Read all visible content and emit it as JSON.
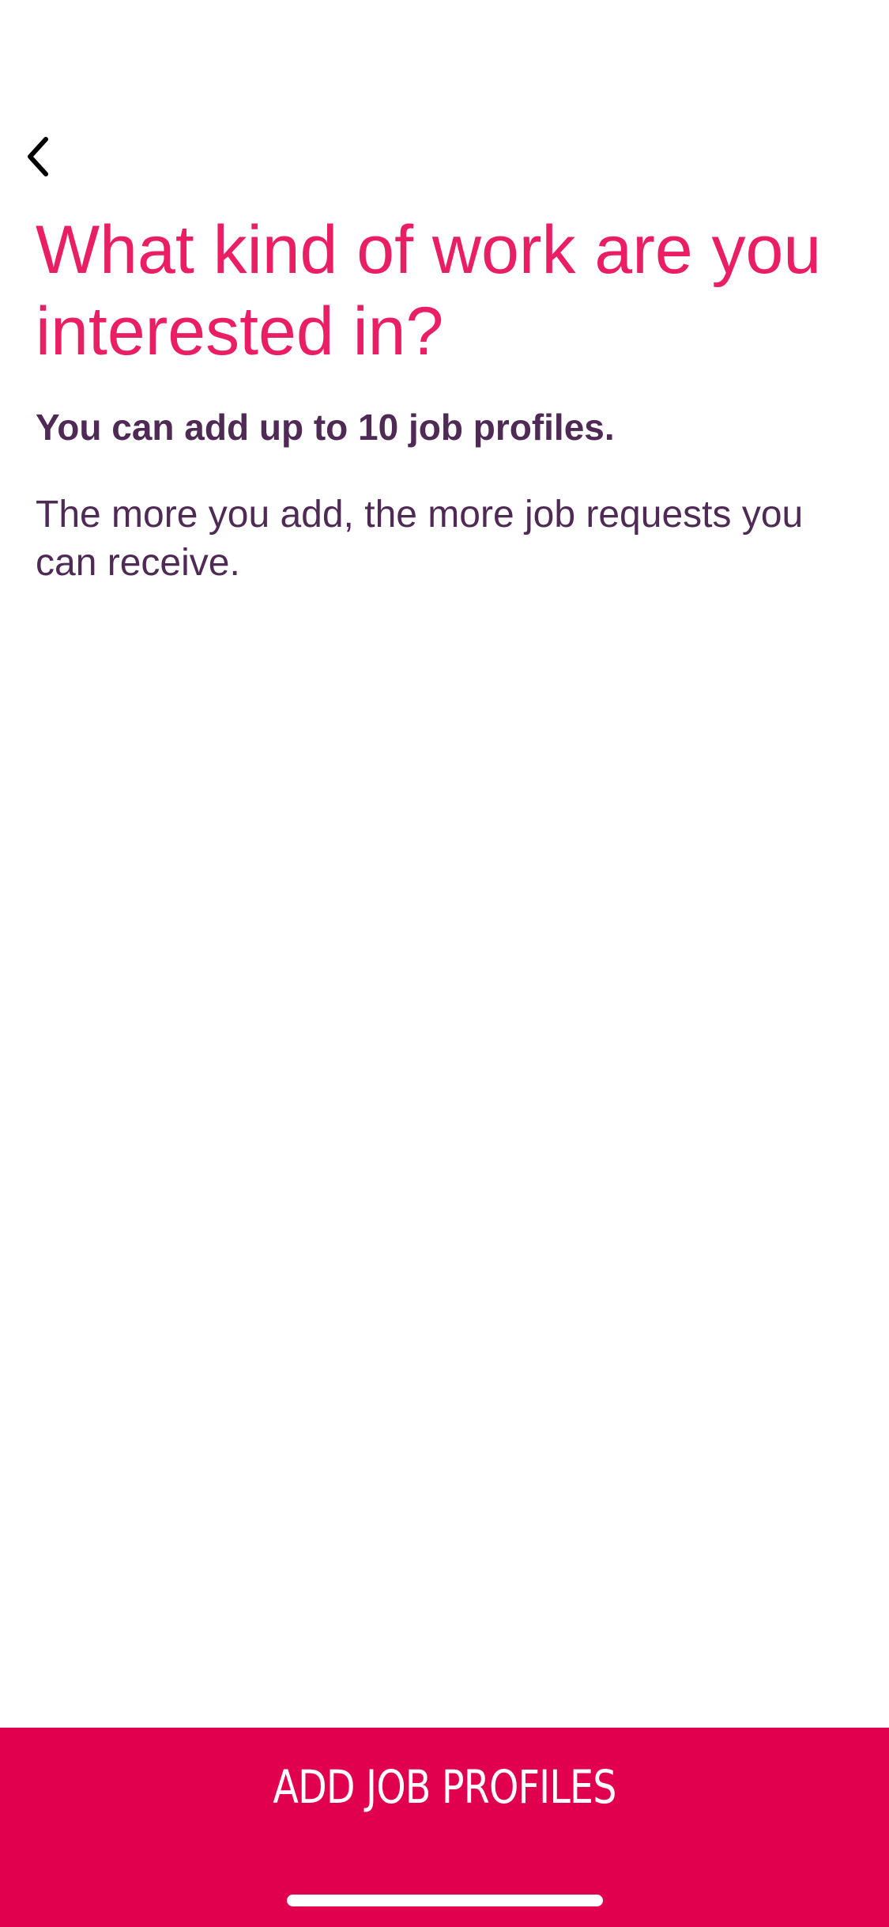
{
  "navigation": {
    "back_icon": "chevron-left-icon"
  },
  "content": {
    "title": "What kind of work are you interested in?",
    "subtitle": "You can add up to 10 job profiles.",
    "description": "The more you add, the more job requests you can receive."
  },
  "footer": {
    "button_label": "ADD JOB PROFILES"
  },
  "colors": {
    "title": "#e91e63",
    "body_text": "#4e2a55",
    "button_background": "#e0004d",
    "button_text": "#ffffff",
    "background": "#ffffff"
  }
}
